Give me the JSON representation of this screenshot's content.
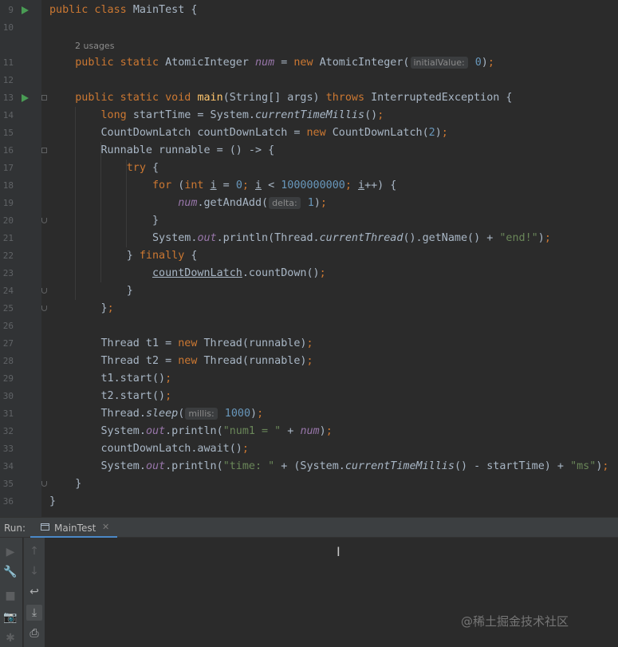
{
  "usage_hint": "2 usages",
  "lines": [
    {
      "num": "9",
      "tokens": [
        {
          "t": "public class ",
          "c": "kw"
        },
        {
          "t": "MainTest {"
        }
      ]
    },
    {
      "num": "10",
      "tokens": []
    },
    {
      "num": "11",
      "tokens": [
        {
          "t": "    "
        },
        {
          "t": "public static ",
          "c": "kw"
        },
        {
          "t": "AtomicInteger "
        },
        {
          "t": "num",
          "c": "fld"
        },
        {
          "t": " = "
        },
        {
          "t": "new ",
          "c": "kw"
        },
        {
          "t": "AtomicInteger("
        },
        {
          "t": "initialValue:",
          "c": "ph"
        },
        {
          "t": " "
        },
        {
          "t": "0",
          "c": "num"
        },
        {
          "t": ")"
        },
        {
          "t": ";",
          "c": "kw"
        }
      ]
    },
    {
      "num": "12",
      "tokens": []
    },
    {
      "num": "13",
      "tokens": [
        {
          "t": "    "
        },
        {
          "t": "public static void ",
          "c": "kw"
        },
        {
          "t": "main",
          "c": "fn"
        },
        {
          "t": "(String[] args) "
        },
        {
          "t": "throws ",
          "c": "kw"
        },
        {
          "t": "InterruptedException {"
        }
      ]
    },
    {
      "num": "14",
      "tokens": [
        {
          "t": "        "
        },
        {
          "t": "long ",
          "c": "kw"
        },
        {
          "t": "startTime = System."
        },
        {
          "t": "currentTimeMillis",
          "c": "st"
        },
        {
          "t": "()"
        },
        {
          "t": ";",
          "c": "kw"
        }
      ]
    },
    {
      "num": "15",
      "tokens": [
        {
          "t": "        CountDownLatch countDownLatch = "
        },
        {
          "t": "new ",
          "c": "kw"
        },
        {
          "t": "CountDownLatch("
        },
        {
          "t": "2",
          "c": "num"
        },
        {
          "t": ")"
        },
        {
          "t": ";",
          "c": "kw"
        }
      ]
    },
    {
      "num": "16",
      "tokens": [
        {
          "t": "        Runnable runnable = () -> {"
        }
      ]
    },
    {
      "num": "17",
      "tokens": [
        {
          "t": "            "
        },
        {
          "t": "try ",
          "c": "kw"
        },
        {
          "t": "{"
        }
      ]
    },
    {
      "num": "18",
      "tokens": [
        {
          "t": "                "
        },
        {
          "t": "for ",
          "c": "kw"
        },
        {
          "t": "("
        },
        {
          "t": "int ",
          "c": "kw"
        },
        {
          "t": "i",
          "c": "ul"
        },
        {
          "t": " = "
        },
        {
          "t": "0",
          "c": "num"
        },
        {
          "t": "; ",
          "c": "kw"
        },
        {
          "t": "i",
          "c": "ul"
        },
        {
          "t": " < "
        },
        {
          "t": "1000000000",
          "c": "num"
        },
        {
          "t": "; ",
          "c": "kw"
        },
        {
          "t": "i",
          "c": "ul"
        },
        {
          "t": "++) {"
        }
      ]
    },
    {
      "num": "19",
      "tokens": [
        {
          "t": "                    "
        },
        {
          "t": "num",
          "c": "fld"
        },
        {
          "t": ".getAndAdd("
        },
        {
          "t": "delta:",
          "c": "ph"
        },
        {
          "t": " "
        },
        {
          "t": "1",
          "c": "num"
        },
        {
          "t": ")"
        },
        {
          "t": ";",
          "c": "kw"
        }
      ]
    },
    {
      "num": "20",
      "tokens": [
        {
          "t": "                }"
        }
      ]
    },
    {
      "num": "21",
      "tokens": [
        {
          "t": "                System."
        },
        {
          "t": "out",
          "c": "fld"
        },
        {
          "t": ".println(Thread."
        },
        {
          "t": "currentThread",
          "c": "st"
        },
        {
          "t": "().getName() + "
        },
        {
          "t": "\"end!\"",
          "c": "str"
        },
        {
          "t": ")"
        },
        {
          "t": ";",
          "c": "kw"
        }
      ]
    },
    {
      "num": "22",
      "tokens": [
        {
          "t": "            } "
        },
        {
          "t": "finally ",
          "c": "kw"
        },
        {
          "t": "{"
        }
      ]
    },
    {
      "num": "23",
      "tokens": [
        {
          "t": "                "
        },
        {
          "t": "countDownLatch",
          "c": "ul"
        },
        {
          "t": ".countDown()"
        },
        {
          "t": ";",
          "c": "kw"
        }
      ]
    },
    {
      "num": "24",
      "tokens": [
        {
          "t": "            }"
        }
      ]
    },
    {
      "num": "25",
      "tokens": [
        {
          "t": "        }"
        },
        {
          "t": ";",
          "c": "kw"
        }
      ]
    },
    {
      "num": "26",
      "tokens": []
    },
    {
      "num": "27",
      "tokens": [
        {
          "t": "        Thread t1 = "
        },
        {
          "t": "new ",
          "c": "kw"
        },
        {
          "t": "Thread(runnable)"
        },
        {
          "t": ";",
          "c": "kw"
        }
      ]
    },
    {
      "num": "28",
      "tokens": [
        {
          "t": "        Thread t2 = "
        },
        {
          "t": "new ",
          "c": "kw"
        },
        {
          "t": "Thread(runnable)"
        },
        {
          "t": ";",
          "c": "kw"
        }
      ]
    },
    {
      "num": "29",
      "tokens": [
        {
          "t": "        t1.start()"
        },
        {
          "t": ";",
          "c": "kw"
        }
      ]
    },
    {
      "num": "30",
      "tokens": [
        {
          "t": "        t2.start()"
        },
        {
          "t": ";",
          "c": "kw"
        }
      ]
    },
    {
      "num": "31",
      "tokens": [
        {
          "t": "        Thread."
        },
        {
          "t": "sleep",
          "c": "st"
        },
        {
          "t": "("
        },
        {
          "t": "millis:",
          "c": "ph"
        },
        {
          "t": " "
        },
        {
          "t": "1000",
          "c": "num"
        },
        {
          "t": ")"
        },
        {
          "t": ";",
          "c": "kw"
        }
      ]
    },
    {
      "num": "32",
      "tokens": [
        {
          "t": "        System."
        },
        {
          "t": "out",
          "c": "fld"
        },
        {
          "t": ".println("
        },
        {
          "t": "\"num1 = \"",
          "c": "str"
        },
        {
          "t": " + "
        },
        {
          "t": "num",
          "c": "fld"
        },
        {
          "t": ")"
        },
        {
          "t": ";",
          "c": "kw"
        }
      ]
    },
    {
      "num": "33",
      "tokens": [
        {
          "t": "        countDownLatch.await()"
        },
        {
          "t": ";",
          "c": "kw"
        }
      ]
    },
    {
      "num": "34",
      "tokens": [
        {
          "t": "        System."
        },
        {
          "t": "out",
          "c": "fld"
        },
        {
          "t": ".println("
        },
        {
          "t": "\"time: \"",
          "c": "str"
        },
        {
          "t": " + (System."
        },
        {
          "t": "currentTimeMillis",
          "c": "st"
        },
        {
          "t": "() - startTime) + "
        },
        {
          "t": "\"ms\"",
          "c": "str"
        },
        {
          "t": ")"
        },
        {
          "t": ";",
          "c": "kw"
        }
      ]
    },
    {
      "num": "35",
      "tokens": [
        {
          "t": "    }"
        }
      ]
    },
    {
      "num": "36",
      "tokens": [
        {
          "t": "}"
        }
      ]
    }
  ],
  "run_panel": {
    "label": "Run:",
    "tab_label": "MainTest",
    "tab_close": "✕"
  },
  "toolbar_left": [
    {
      "name": "rerun-icon",
      "glyph": "▶",
      "state": "disabled"
    },
    {
      "name": "wrench-icon",
      "glyph": "🔧",
      "state": "enabled"
    },
    {
      "name": "stop-icon",
      "glyph": "■",
      "state": "disabled"
    },
    {
      "name": "camera-icon",
      "glyph": "📷",
      "state": "disabled"
    },
    {
      "name": "bug-icon",
      "glyph": "✱",
      "state": "disabled"
    }
  ],
  "toolbar_right": [
    {
      "name": "up-arrow-icon",
      "glyph": "↑",
      "state": "disabled"
    },
    {
      "name": "down-arrow-icon",
      "glyph": "↓",
      "state": "disabled"
    },
    {
      "name": "soft-wrap-icon",
      "glyph": "↩",
      "state": "enabled"
    },
    {
      "name": "scroll-to-end-icon",
      "glyph": "⤓",
      "state": "active"
    },
    {
      "name": "print-icon",
      "glyph": "⎙",
      "state": "enabled"
    }
  ],
  "watermark": "@稀土掘金技术社区"
}
